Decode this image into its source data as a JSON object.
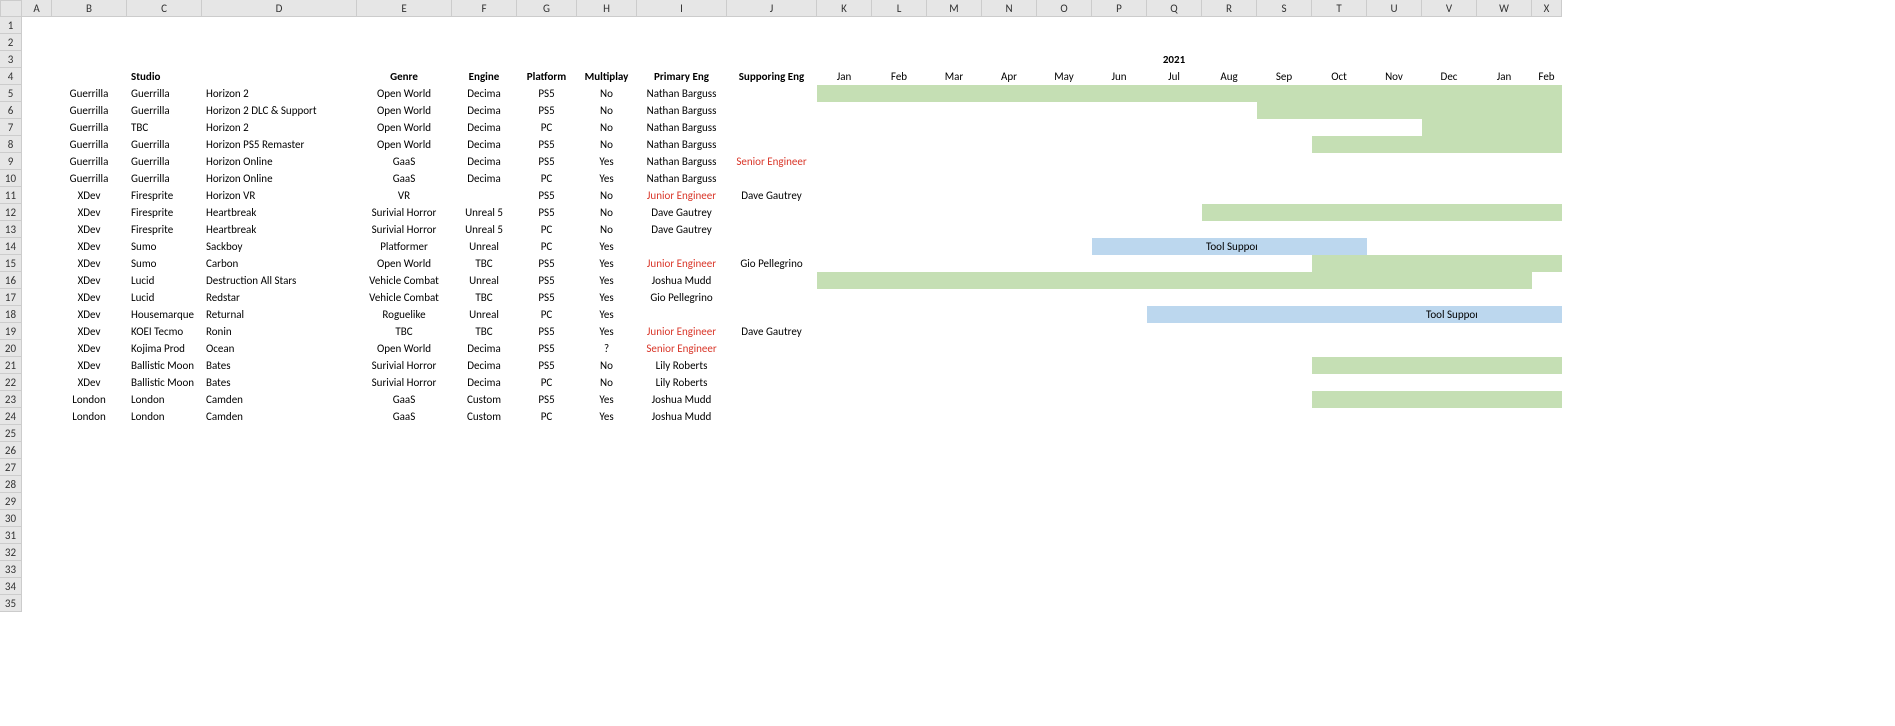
{
  "columns": [
    "A",
    "B",
    "C",
    "D",
    "E",
    "F",
    "G",
    "H",
    "I",
    "J",
    "K",
    "L",
    "M",
    "N",
    "O",
    "P",
    "Q",
    "R",
    "S",
    "T",
    "U",
    "V",
    "W",
    "X"
  ],
  "colWidths": {
    "A": 30,
    "B": 75,
    "C": 75,
    "D": 155,
    "E": 95,
    "F": 65,
    "G": 60,
    "H": 60,
    "I": 90,
    "J": 90,
    "K": 55,
    "L": 55,
    "M": 55,
    "N": 55,
    "O": 55,
    "P": 55,
    "Q": 55,
    "R": 55,
    "S": 55,
    "T": 55,
    "U": 55,
    "V": 55,
    "W": 55,
    "X": 30
  },
  "yearHeader": {
    "text": "2021",
    "col": "Q",
    "row": 3
  },
  "headers": {
    "row": 4,
    "C": "Studio",
    "E": "Genre",
    "F": "Engine",
    "G": "Platform",
    "H": "Multiplay",
    "I": "Primary Eng",
    "J": "Supporing Eng"
  },
  "months": [
    "Jan",
    "Feb",
    "Mar",
    "Apr",
    "May",
    "Jun",
    "Jul",
    "Aug",
    "Sep",
    "Oct",
    "Nov",
    "Dec",
    "Jan",
    "Feb"
  ],
  "monthCols": [
    "K",
    "L",
    "M",
    "N",
    "O",
    "P",
    "Q",
    "R",
    "S",
    "T",
    "U",
    "V",
    "W",
    "X"
  ],
  "rows": [
    {
      "r": 5,
      "B": "Guerrilla",
      "C": "Guerrilla",
      "D": "Horizon 2",
      "E": "Open World",
      "F": "Decima",
      "G": "PS5",
      "H": "No",
      "I": "Nathan Barguss",
      "bar": {
        "from": "K",
        "to": "X",
        "cls": "green"
      }
    },
    {
      "r": 6,
      "B": "Guerrilla",
      "C": "Guerrilla",
      "D": "Horizon 2 DLC & Support",
      "E": "Open World",
      "F": "Decima",
      "G": "PS5",
      "H": "No",
      "I": "Nathan Barguss",
      "bar": {
        "from": "S",
        "to": "X",
        "cls": "green"
      }
    },
    {
      "r": 7,
      "B": "Guerrilla",
      "C": "TBC",
      "D": "Horizon 2",
      "E": "Open World",
      "F": "Decima",
      "G": "PC",
      "H": "No",
      "I": "Nathan Barguss",
      "bar": {
        "from": "V",
        "to": "X",
        "cls": "green"
      }
    },
    {
      "r": 8,
      "B": "Guerrilla",
      "C": "Guerrilla",
      "D": "Horizon PS5 Remaster",
      "E": "Open World",
      "F": "Decima",
      "G": "PS5",
      "H": "No",
      "I": "Nathan Barguss",
      "bar": {
        "from": "T",
        "to": "X",
        "cls": "green"
      }
    },
    {
      "r": 9,
      "B": "Guerrilla",
      "C": "Guerrilla",
      "D": "Horizon Online",
      "E": "GaaS",
      "F": "Decima",
      "G": "PS5",
      "H": "Yes",
      "I": "Nathan Barguss",
      "J": "Senior Engineer",
      "Jred": true
    },
    {
      "r": 10,
      "B": "Guerrilla",
      "C": "Guerrilla",
      "D": "Horizon Online",
      "E": "GaaS",
      "F": "Decima",
      "G": "PC",
      "H": "Yes",
      "I": "Nathan Barguss"
    },
    {
      "r": 11,
      "B": "XDev",
      "C": "Firesprite",
      "D": "Horizon VR",
      "E": "VR",
      "G": "PS5",
      "H": "No",
      "I": "Junior Engineer",
      "Ired": true,
      "J": "Dave Gautrey"
    },
    {
      "r": 12,
      "B": "XDev",
      "C": "Firesprite",
      "D": "Heartbreak",
      "E": "Surivial Horror",
      "F": "Unreal 5",
      "G": "PS5",
      "H": "No",
      "I": "Dave Gautrey",
      "bar": {
        "from": "R",
        "to": "X",
        "cls": "green"
      }
    },
    {
      "r": 13,
      "B": "XDev",
      "C": "Firesprite",
      "D": "Heartbreak",
      "E": "Surivial Horror",
      "F": "Unreal 5",
      "G": "PC",
      "H": "No",
      "I": "Dave Gautrey"
    },
    {
      "r": 14,
      "B": "XDev",
      "C": "Sumo",
      "D": "Sackboy",
      "E": "Platformer",
      "F": "Unreal",
      "G": "PC",
      "H": "Yes",
      "bar": {
        "from": "P",
        "to": "T",
        "cls": "blue",
        "label": "Tool Support Only"
      }
    },
    {
      "r": 15,
      "B": "XDev",
      "C": "Sumo",
      "D": "Carbon",
      "E": "Open World",
      "F": "TBC",
      "G": "PS5",
      "H": "Yes",
      "I": "Junior Engineer",
      "Ired": true,
      "J": "Gio Pellegrino",
      "bar": {
        "from": "T",
        "to": "X",
        "cls": "green"
      }
    },
    {
      "r": 16,
      "B": "XDev",
      "C": "Lucid",
      "D": "Destruction All Stars",
      "E": "Vehicle Combat",
      "F": "Unreal",
      "G": "PS5",
      "H": "Yes",
      "I": "Joshua Mudd",
      "bar": {
        "from": "K",
        "to": "W",
        "cls": "green"
      }
    },
    {
      "r": 17,
      "B": "XDev",
      "C": "Lucid",
      "D": "Redstar",
      "E": "Vehicle Combat",
      "F": "TBC",
      "G": "PS5",
      "H": "Yes",
      "I": "Gio Pellegrino"
    },
    {
      "r": 18,
      "B": "XDev",
      "C": "Housemarque",
      "D": "Returnal",
      "E": "Roguelike",
      "F": "Unreal",
      "G": "PC",
      "H": "Yes",
      "bar": {
        "from": "Q",
        "to": "X",
        "cls": "blue",
        "label": "Tool Support Only",
        "labelCenter": "V"
      }
    },
    {
      "r": 19,
      "B": "XDev",
      "C": "KOEI Tecmo",
      "D": "Ronin",
      "E": "TBC",
      "F": "TBC",
      "G": "PS5",
      "H": "Yes",
      "I": "Junior Engineer",
      "Ired": true,
      "J": "Dave Gautrey"
    },
    {
      "r": 20,
      "B": "XDev",
      "C": "Kojima Prod",
      "D": "Ocean",
      "E": "Open World",
      "F": "Decima",
      "G": "PS5",
      "H": "?",
      "I": "Senior Engineer",
      "Ired": true
    },
    {
      "r": 21,
      "B": "XDev",
      "C": "Ballistic Moon",
      "D": "Bates",
      "E": "Surivial Horror",
      "F": "Decima",
      "G": "PS5",
      "H": "No",
      "I": "Lily Roberts",
      "bar": {
        "from": "T",
        "to": "X",
        "cls": "green"
      }
    },
    {
      "r": 22,
      "B": "XDev",
      "C": "Ballistic Moon",
      "D": "Bates",
      "E": "Surivial Horror",
      "F": "Decima",
      "G": "PC",
      "H": "No",
      "I": "Lily Roberts"
    },
    {
      "r": 23,
      "B": "London",
      "C": "London",
      "D": "Camden",
      "E": "GaaS",
      "F": "Custom",
      "G": "PS5",
      "H": "Yes",
      "I": "Joshua Mudd",
      "bar": {
        "from": "T",
        "to": "X",
        "cls": "green"
      }
    },
    {
      "r": 24,
      "B": "London",
      "C": "London",
      "D": "Camden",
      "E": "GaaS",
      "F": "Custom",
      "G": "PC",
      "H": "Yes",
      "I": "Joshua Mudd"
    }
  ],
  "emptyRows": [
    1,
    2,
    25,
    26,
    27,
    28,
    29,
    30,
    31,
    32,
    33,
    34,
    35
  ]
}
